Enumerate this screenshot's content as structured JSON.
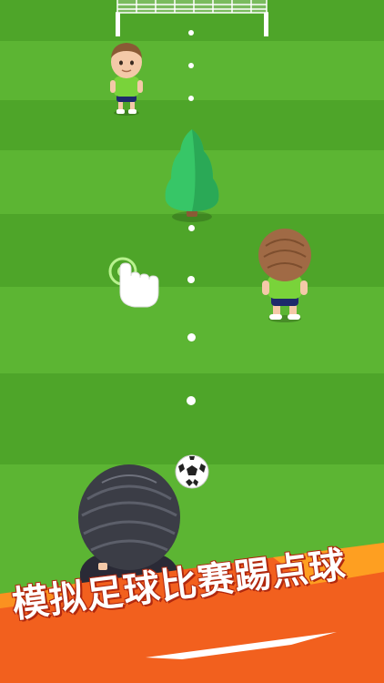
{
  "game": {
    "scene": "soccer-penalty-kick",
    "field_colors": {
      "light": "#5cb533",
      "dark": "#4fa52a"
    },
    "aim_dots": 7
  },
  "banner": {
    "text": "模拟足球比赛踢点球",
    "bg_color": "#f2601e",
    "accent_color": "#ffa621"
  },
  "icons": [
    "goal-net-icon",
    "tree-icon",
    "tap-hand-icon",
    "soccer-ball-icon"
  ]
}
